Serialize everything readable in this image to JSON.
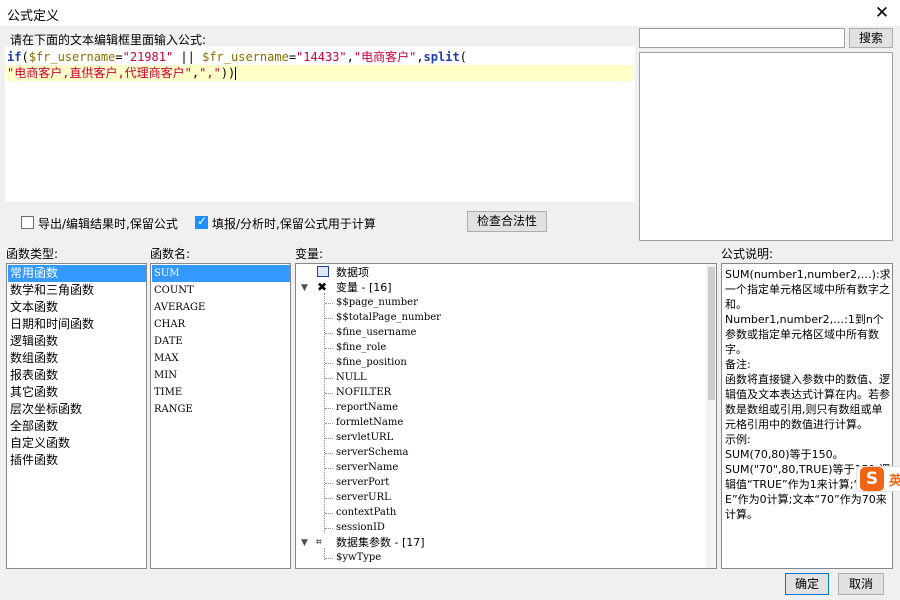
{
  "window": {
    "title": "公式定义",
    "close_symbol": "✕"
  },
  "editor": {
    "prompt": "请在下面的文本编辑框里面输入公式:",
    "line1": [
      {
        "t": "if",
        "c": "kw"
      },
      {
        "t": "(",
        "c": ""
      },
      {
        "t": "$fr_username",
        "c": "var"
      },
      {
        "t": "=",
        "c": ""
      },
      {
        "t": "\"21981\"",
        "c": "str"
      },
      {
        "t": " || ",
        "c": ""
      },
      {
        "t": "$fr_username",
        "c": "var"
      },
      {
        "t": "=",
        "c": ""
      },
      {
        "t": "\"14433\"",
        "c": "str"
      },
      {
        "t": ",",
        "c": ""
      },
      {
        "t": "\"电商客户\"",
        "c": "str"
      },
      {
        "t": ",",
        "c": ""
      },
      {
        "t": "split",
        "c": "kw"
      },
      {
        "t": "(",
        "c": ""
      }
    ],
    "line2": [
      {
        "t": "\"电商客户,直供客户,代理商客户\"",
        "c": "str"
      },
      {
        "t": ",",
        "c": ""
      },
      {
        "t": "\",\"",
        "c": "str"
      },
      {
        "t": "))",
        "c": ""
      }
    ]
  },
  "search": {
    "value": "",
    "button_label": "搜索"
  },
  "options": {
    "keep_formula_export": {
      "label": "导出/编辑结果时,保留公式",
      "checked": false
    },
    "keep_formula_fill": {
      "label": "填报/分析时,保留公式用于计算",
      "checked": true
    },
    "check_button": "检查合法性"
  },
  "sections": {
    "categories": "函数类型:",
    "functions": "函数名:",
    "variables": "变量:",
    "description": "公式说明:"
  },
  "categories": [
    "常用函数",
    "数学和三角函数",
    "文本函数",
    "日期和时间函数",
    "逻辑函数",
    "数组函数",
    "报表函数",
    "其它函数",
    "层次坐标函数",
    "全部函数",
    "自定义函数",
    "插件函数"
  ],
  "selected_category": 0,
  "functions": [
    "SUM",
    "COUNT",
    "AVERAGE",
    "CHAR",
    "DATE",
    "MAX",
    "MIN",
    "TIME",
    "RANGE"
  ],
  "selected_function": 0,
  "variables": {
    "data_items_label": "数据项",
    "vars_label": "变量 - [16]",
    "vars": [
      "$$page_number",
      "$$totalPage_number",
      "$fine_username",
      "$fine_role",
      "$fine_position",
      "NULL",
      "NOFILTER",
      "reportName",
      "formletName",
      "servletURL",
      "serverSchema",
      "serverName",
      "serverPort",
      "serverURL",
      "contextPath",
      "sessionID"
    ],
    "dataset_params_label": "数据集参数 - [17]",
    "dataset_params": [
      "$ywType"
    ]
  },
  "description": "SUM(number1,number2,…):求一个指定单元格区域中所有数字之和。\nNumber1,number2,…:1到n个参数或指定单元格区域中所有数字。\n备注:\n函数将直接键入参数中的数值、逻辑值及文本表达式计算在内。若参数是数组或引用,则只有数组或单元格引用中的数值进行计算。\n示例:\nSUM(70,80)等于150。\nSUM(\"70\",80,TRUE)等于151,逻辑值“TRUE”作为1来计算;“FALSE”作为0计算;文本“70”作为70来计算。",
  "ime": {
    "logo": "S",
    "mode": "英"
  },
  "buttons": {
    "ok": "确定",
    "cancel": "取消"
  }
}
